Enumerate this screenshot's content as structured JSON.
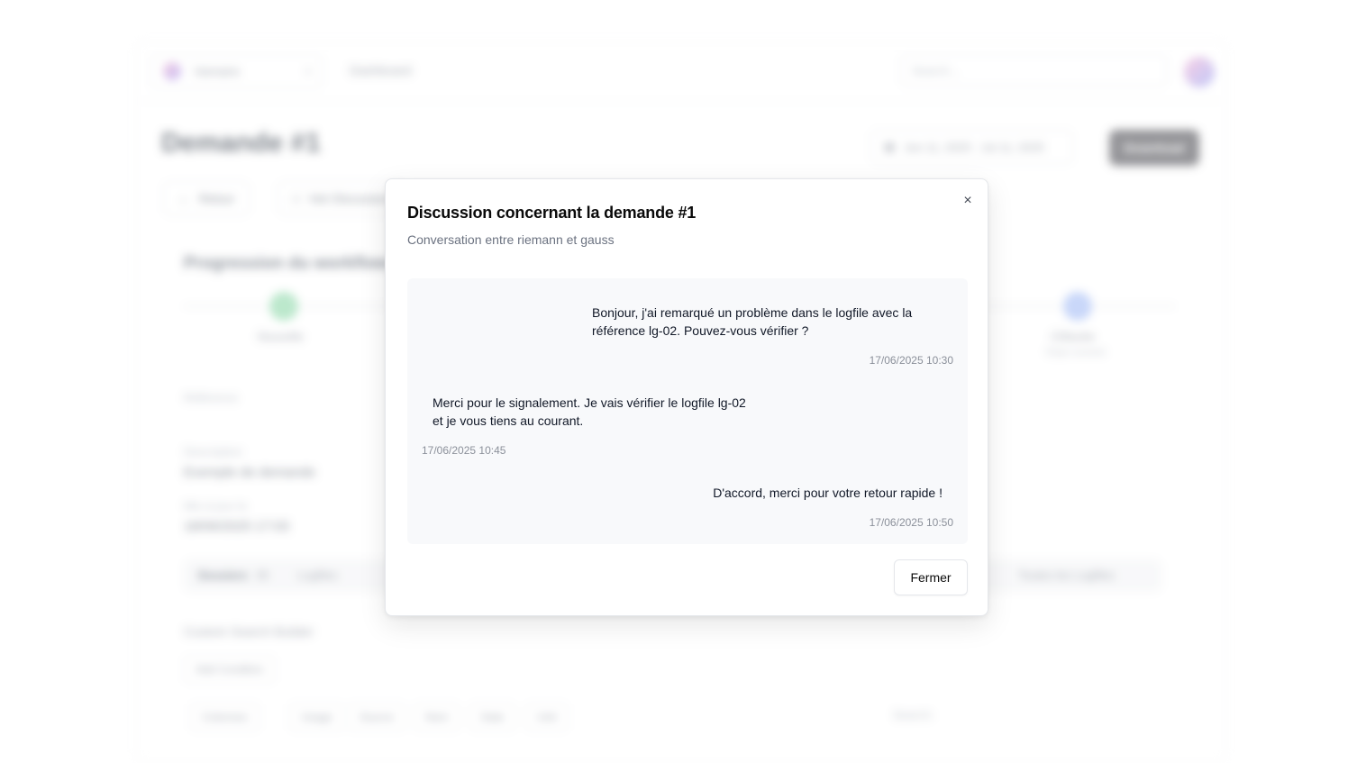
{
  "background": {
    "org_name": "Vamaire",
    "nav_label": "Dashboard",
    "search_placeholder": "Search...",
    "page_title": "Demande #1",
    "date_range": "Jun 11, 2025 - Jul 11, 2025",
    "download_label": "Download",
    "back_label": "Retour",
    "discussion_label": "Voir Discussion",
    "section_title": "Progression du workflow",
    "steps": [
      {
        "label": "Nouvelle",
        "sub": ""
      },
      {
        "label": "Clôturée",
        "sub": "Étape suivante"
      }
    ],
    "fields": {
      "reference_label": "Référence",
      "description_label": "Description",
      "description_value": "Exemple de demande",
      "updated_label": "Mis à jour le",
      "updated_value": "18/06/2025 17:03"
    },
    "tabs": {
      "first": "Dossiers",
      "first_count": "35",
      "second": "Logfiles",
      "third": "Toutes les Logfiles"
    },
    "custom_section": "Custom Search Builder",
    "add_condition": "Add Condition",
    "columns": [
      "Colonnes",
      "Usage",
      "Source",
      "Nom",
      "Date",
      "Unit"
    ],
    "search_label": "Search:"
  },
  "modal": {
    "title": "Discussion concernant la demande #1",
    "subtitle": "Conversation entre riemann et gauss",
    "close_icon": "×",
    "messages": [
      {
        "line1": "Bonjour, j'ai remarqué un problème dans le logfile avec la",
        "line2": "référence lg-02. Pouvez-vous vérifier ?",
        "time": "17/06/2025 10:30"
      },
      {
        "line1": "Merci pour le signalement. Je vais vérifier le logfile lg-02",
        "line2": "et je vous tiens au courant.",
        "time": "17/06/2025 10:45"
      },
      {
        "line1": "D'accord, merci pour votre retour rapide !",
        "time": "17/06/2025 10:50"
      }
    ],
    "close_button": "Fermer"
  }
}
